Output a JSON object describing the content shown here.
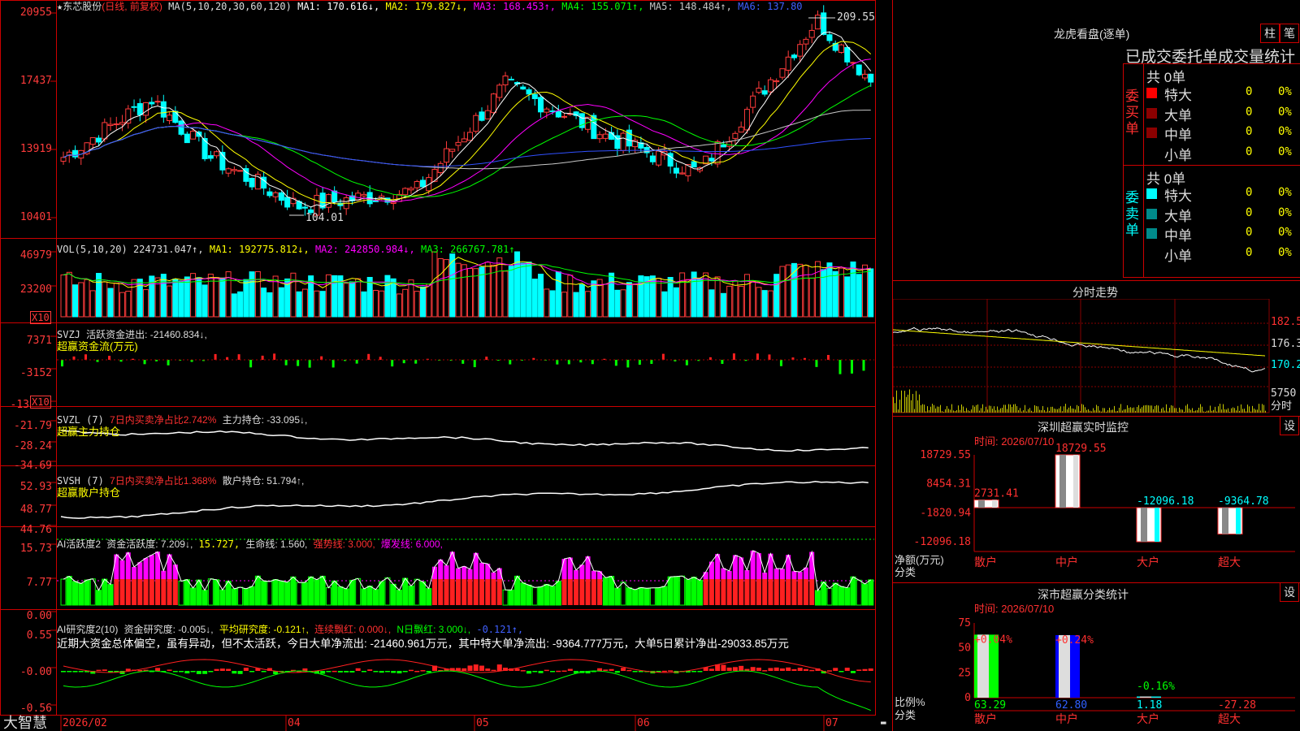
{
  "main_panel": {
    "star": "★",
    "stock_name": "东芯股份",
    "period": "(日线, 前复权)",
    "ma_label": "MA(5,10,20,30,60,120)",
    "ma1": "MA1: 170.616↓,",
    "ma2": "MA2: 179.827↓,",
    "ma3": "MA3: 168.453↑,",
    "ma4": "MA4: 155.071↑,",
    "ma5": "MA5: 148.484↑,",
    "ma6": "MA6: 137.80",
    "y_labels": [
      "20955",
      "17437",
      "13919",
      "10401"
    ],
    "high_marker": "209.55",
    "low_marker": "104.01"
  },
  "vol_panel": {
    "label": "VOL(5,10,20)",
    "value": "224731.047↑,",
    "ma1": "MA1: 192775.812↓,",
    "ma2": "MA2: 242850.984↓,",
    "ma3": "MA3: 266767.781↑",
    "y_labels": [
      "46979",
      "23200"
    ],
    "unit": "X10"
  },
  "svzj_panel": {
    "label": "SVZJ",
    "active": "活跃资金进出: -21460.834↓,",
    "subtitle": "超赢资金流(万元)",
    "y_labels": [
      "7371",
      "-3152",
      "-13"
    ],
    "unit": "X10"
  },
  "svzl_panel": {
    "label": "SVZL (7)",
    "ratio": "7日内买卖净占比2.742%",
    "hold": "主力持仓: -33.095↓,",
    "subtitle": "超赢主力持仓",
    "y_labels": [
      "-21.79",
      "-28.24",
      "-34.69"
    ]
  },
  "svsh_panel": {
    "label": "SVSH (7)",
    "ratio": "7日内买卖净占比1.368%",
    "hold": "散户持仓: 51.794↑,",
    "subtitle": "超赢散户持仓",
    "y_labels": [
      "52.93",
      "48.77",
      "44.76"
    ]
  },
  "ai_active_panel": {
    "label": "AI活跃度2",
    "fund": "资金活跃度: 7.209↓,",
    "v2": "15.727,",
    "life": "生命线: 1.560,",
    "strong": "强势线: 3.000,",
    "burst": "爆发线: 6.000,",
    "y_labels": [
      "15.73",
      "7.77",
      "0.00"
    ]
  },
  "ai_research_panel": {
    "label": "AI研究度2(10)",
    "fund": "资金研究度: -0.005↓,",
    "avg": "平均研究度: -0.121↑,",
    "cont": "连续飘红: 0.000↓,",
    "nday": "N日飘红: 3.000↓,",
    "last": "-0.121↑,",
    "comment": "近期大资金总体偏空，虽有异动，但不太活跃，今日大单净流出: -21460.961万元，其中特大单净流出: -9364.777万元，大单5日累计净出-29033.85万元",
    "y_labels": [
      "0.55",
      "-0.00",
      "-0.56"
    ]
  },
  "bottom_bar": {
    "logo": "大智慧",
    "dates": [
      "2026/02",
      "04",
      "05",
      "06",
      "07"
    ]
  },
  "dragon_tiger": {
    "title": "龙虎看盘(逐单)",
    "btn1": "柱",
    "btn2": "笔",
    "header": "已成交委托单成交量统计",
    "buy_label": "委买单",
    "sell_label": "委卖单",
    "buy_total": "共 0单",
    "sell_total": "共 0单",
    "rows": [
      {
        "name": "特大",
        "count": "0",
        "pct": "0%"
      },
      {
        "name": "大单",
        "count": "0",
        "pct": "0%"
      },
      {
        "name": "中单",
        "count": "0",
        "pct": "0%"
      },
      {
        "name": "小单",
        "count": "0",
        "pct": "0%"
      }
    ],
    "buy_colors": [
      "#ff0000",
      "#8b0000",
      "#8b0000",
      "#000000"
    ],
    "sell_colors": [
      "#00ffff",
      "#008b8b",
      "#008b8b",
      "#000000"
    ]
  },
  "intraday": {
    "title": "分时走势",
    "prices": [
      "182.5",
      "176.3",
      "170.2"
    ],
    "vol": "5750",
    "tag": "分时"
  },
  "sz_monitor": {
    "title": "深圳超赢实时监控",
    "btn": "设",
    "time": "时间: 2026/07/10",
    "y_labels": [
      "18729.55",
      "8454.31",
      "-1820.94",
      "-12096.18"
    ],
    "axis_title1": "净额(万元)",
    "axis_title2": "分类",
    "categories": [
      "散户",
      "中户",
      "大户",
      "超大"
    ],
    "values": [
      2731.41,
      18729.55,
      -12096.18,
      -9364.78
    ],
    "value_labels": [
      "2731.41",
      "18729.55",
      "-12096.18",
      "-9364.78"
    ]
  },
  "sz_class": {
    "title": "深市超赢分类统计",
    "btn": "设",
    "time": "时间: 2026/07/10",
    "y_labels": [
      "75",
      "50",
      "25",
      "0"
    ],
    "axis_title1": "比例%",
    "axis_title2": "分类",
    "categories": [
      "散户",
      "中户",
      "大户",
      "超大"
    ],
    "changes": [
      "+0.04%",
      "+0.24%",
      "-0.16%",
      ""
    ],
    "values": [
      63.29,
      62.8,
      1.18,
      -27.28
    ],
    "value_labels": [
      "63.29",
      "62.80",
      "1.18",
      "-27.28"
    ]
  }
}
